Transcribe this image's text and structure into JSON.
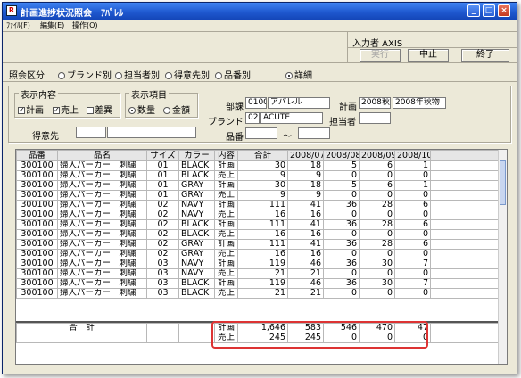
{
  "window": {
    "title": "計画進捗状況照会　ｱﾊﾟﾚﾙ",
    "app_icon": "R"
  },
  "menubar": {
    "items": [
      "ﾌｧｲﾙ(F)",
      "編集(E)",
      "操作(O)"
    ]
  },
  "header": {
    "user_label": "入力者 AXIS",
    "btn_run": "実行",
    "btn_stop": "中止",
    "btn_exit": "終了"
  },
  "filter": {
    "label": "照会区分",
    "options": [
      "ブランド別",
      "担当者別",
      "得意先別",
      "品番別",
      "詳細"
    ],
    "selected_index": 4
  },
  "display_group": {
    "title": "表示内容",
    "checks": [
      {
        "label": "計画",
        "checked": true
      },
      {
        "label": "売上",
        "checked": true
      },
      {
        "label": "差異",
        "checked": false
      }
    ],
    "customer_label": "得意先"
  },
  "item_group": {
    "title": "表示項目",
    "options": [
      "数量",
      "金額"
    ],
    "selected_index": 0
  },
  "conditions": {
    "dept_label": "部課",
    "dept_code": "0100",
    "dept_name": "アパレル",
    "plan_label": "計画",
    "plan_code": "2008秋",
    "plan_name": "2008年秋物",
    "brand_label": "ブランド",
    "brand_code": "02",
    "brand_name": "ACUTE",
    "manager_label": "担当者",
    "item_label": "品番",
    "range_sep": "〜"
  },
  "grid": {
    "columns": [
      "品番",
      "品名",
      "サイズ",
      "カラー",
      "内容",
      "合計",
      "2008/07",
      "2008/08",
      "2008/09",
      "2008/10"
    ],
    "rows": [
      [
        "300100",
        "婦人パーカー　刺繍",
        "01",
        "BLACK",
        "計画",
        "30",
        "18",
        "5",
        "6",
        "1"
      ],
      [
        "300100",
        "婦人パーカー　刺繍",
        "01",
        "BLACK",
        "売上",
        "9",
        "9",
        "0",
        "0",
        "0"
      ],
      [
        "300100",
        "婦人パーカー　刺繍",
        "01",
        "GRAY",
        "計画",
        "30",
        "18",
        "5",
        "6",
        "1"
      ],
      [
        "300100",
        "婦人パーカー　刺繍",
        "01",
        "GRAY",
        "売上",
        "9",
        "9",
        "0",
        "0",
        "0"
      ],
      [
        "300100",
        "婦人パーカー　刺繍",
        "02",
        "NAVY",
        "計画",
        "111",
        "41",
        "36",
        "28",
        "6"
      ],
      [
        "300100",
        "婦人パーカー　刺繍",
        "02",
        "NAVY",
        "売上",
        "16",
        "16",
        "0",
        "0",
        "0"
      ],
      [
        "300100",
        "婦人パーカー　刺繍",
        "02",
        "BLACK",
        "計画",
        "111",
        "41",
        "36",
        "28",
        "6"
      ],
      [
        "300100",
        "婦人パーカー　刺繍",
        "02",
        "BLACK",
        "売上",
        "16",
        "16",
        "0",
        "0",
        "0"
      ],
      [
        "300100",
        "婦人パーカー　刺繍",
        "02",
        "GRAY",
        "計画",
        "111",
        "41",
        "36",
        "28",
        "6"
      ],
      [
        "300100",
        "婦人パーカー　刺繍",
        "02",
        "GRAY",
        "売上",
        "16",
        "16",
        "0",
        "0",
        "0"
      ],
      [
        "300100",
        "婦人パーカー　刺繍",
        "03",
        "NAVY",
        "計画",
        "119",
        "46",
        "36",
        "30",
        "7"
      ],
      [
        "300100",
        "婦人パーカー　刺繍",
        "03",
        "NAVY",
        "売上",
        "21",
        "21",
        "0",
        "0",
        "0"
      ],
      [
        "300100",
        "婦人パーカー　刺繍",
        "03",
        "BLACK",
        "計画",
        "119",
        "46",
        "36",
        "30",
        "7"
      ],
      [
        "300100",
        "婦人パーカー　刺繍",
        "03",
        "BLACK",
        "売上",
        "21",
        "21",
        "0",
        "0",
        "0"
      ]
    ],
    "total_label": "合　計",
    "totals": [
      [
        "計画",
        "1,646",
        "583",
        "546",
        "470",
        "47"
      ],
      [
        "売上",
        "245",
        "245",
        "0",
        "0",
        "0"
      ]
    ]
  },
  "colors": {
    "titlebar": "#1f59d0",
    "highlight": "#d33333",
    "window_bg": "#ece9d8"
  }
}
